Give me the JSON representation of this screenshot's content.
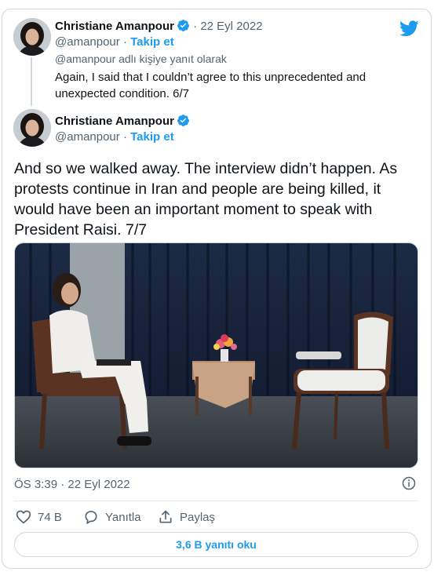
{
  "reply_tweet": {
    "author_name": "Christiane Amanpour",
    "handle": "@amanpour",
    "separator": "·",
    "follow_label": "Takip et",
    "date": "22 Eyl 2022",
    "replying_to": "@amanpour adlı kişiye yanıt olarak",
    "text": "Again, I said that I couldn’t agree to this unprecedented and unexpected condition. 6/7"
  },
  "main_tweet": {
    "author_name": "Christiane Amanpour",
    "handle": "@amanpour",
    "separator": "·",
    "follow_label": "Takip et",
    "text": "And so we walked away. The interview didn’t happen. As protests continue in Iran and people are being killed, it would have been an important moment to speak with President Raisi. 7/7",
    "timestamp": "ÖS 3:39 · 22 Eyl 2022"
  },
  "actions": {
    "likes": "74 B",
    "reply_label": "Yanıtla",
    "share_label": "Paylaş"
  },
  "read_replies_label": "3,6 B yanıtı oku",
  "icons": {
    "logo": "twitter-bird-icon",
    "verified": "verified-badge-icon",
    "info": "info-icon",
    "like": "heart-icon",
    "reply": "comment-icon",
    "share": "share-icon"
  },
  "colors": {
    "accent": "#1d9bf0",
    "text": "#0f1419",
    "muted": "#536471",
    "border": "#cfd9de"
  }
}
